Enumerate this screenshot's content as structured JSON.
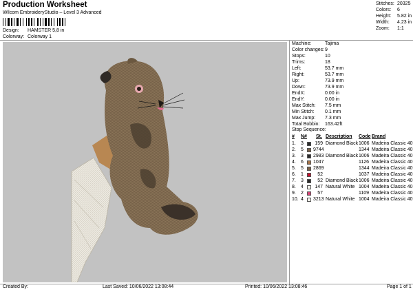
{
  "header": {
    "title": "Production Worksheet",
    "subtitle": "Wilcom EmbroideryStudio – Level 3 Advanced",
    "design_label": "Design:",
    "design_value": "HAMSTER 5,8 in",
    "colorway_label": "Colorway:",
    "colorway_value": "Colorway 1"
  },
  "stats": [
    {
      "label": "Stitches:",
      "value": "20325"
    },
    {
      "label": "Colors:",
      "value": "6"
    },
    {
      "label": "Height:",
      "value": "5.82 in"
    },
    {
      "label": "Width:",
      "value": "4.23 in"
    },
    {
      "label": "Zoom:",
      "value": "1:1"
    }
  ],
  "machine": [
    {
      "label": "Machine:",
      "value": "Tajima"
    },
    {
      "label": "Color changes:",
      "value": "9"
    },
    {
      "label": "Stops:",
      "value": "10"
    },
    {
      "label": "Trims:",
      "value": "18"
    },
    {
      "label": "Left:",
      "value": "53.7 mm"
    },
    {
      "label": "Right:",
      "value": "53.7 mm"
    },
    {
      "label": "Up:",
      "value": "73.9 mm"
    },
    {
      "label": "Down:",
      "value": "73.9 mm"
    },
    {
      "label": "EndX:",
      "value": "0.00 in"
    },
    {
      "label": "EndY:",
      "value": "0.00 in"
    },
    {
      "label": "Max Stitch:",
      "value": "7.5 mm"
    },
    {
      "label": "Min Stitch:",
      "value": "0.1 mm"
    },
    {
      "label": "Max Jump:",
      "value": "7.3 mm"
    },
    {
      "label": "Total Bobbin:",
      "value": "163.42ft"
    }
  ],
  "stop_sequence": {
    "heading": "Stop Sequence:",
    "columns": [
      "#",
      "N#",
      "St.",
      "Description",
      "Code",
      "Brand"
    ],
    "rows": [
      {
        "num": "1.",
        "n": "3",
        "color": "#2b2b2b",
        "st": "159",
        "desc": "Diamond Black",
        "code": "1006",
        "brand": "Madeira Classic 40"
      },
      {
        "num": "2.",
        "n": "5",
        "color": "#7a6148",
        "st": "9744",
        "desc": "",
        "code": "1344",
        "brand": "Madeira Classic 40"
      },
      {
        "num": "3.",
        "n": "3",
        "color": "#2b2b2b",
        "st": "2983",
        "desc": "Diamond Black",
        "code": "1006",
        "brand": "Madeira Classic 40"
      },
      {
        "num": "4.",
        "n": "6",
        "color": "#a8764a",
        "st": "1047",
        "desc": "",
        "code": "1126",
        "brand": "Madeira Classic 40"
      },
      {
        "num": "5.",
        "n": "5",
        "color": "#7a6148",
        "st": "2869",
        "desc": "",
        "code": "1344",
        "brand": "Madeira Classic 40"
      },
      {
        "num": "6.",
        "n": "1",
        "color": "#c8102e",
        "st": "52",
        "desc": "",
        "code": "1037",
        "brand": "Madeira Classic 40"
      },
      {
        "num": "7.",
        "n": "3",
        "color": "#2b2b2b",
        "st": "52",
        "desc": "Diamond Black",
        "code": "1006",
        "brand": "Madeira Classic 40"
      },
      {
        "num": "8.",
        "n": "4",
        "color": "#f4f2ea",
        "st": "147",
        "desc": "Natural White",
        "code": "1004",
        "brand": "Madeira Classic 40"
      },
      {
        "num": "9.",
        "n": "2",
        "color": "#d9477a",
        "st": "57",
        "desc": "",
        "code": "1109",
        "brand": "Madeira Classic 40"
      },
      {
        "num": "10.",
        "n": "4",
        "color": "#f4f2ea",
        "st": "3213",
        "desc": "Natural White",
        "code": "1004",
        "brand": "Madeira Classic 40"
      }
    ]
  },
  "footer": {
    "created": "Created By:",
    "saved": "Last Saved: 10/06/2022 13:08:44",
    "printed": "Printed: 10/06/2022 13:08:46",
    "page": "Page 1 of 1"
  }
}
